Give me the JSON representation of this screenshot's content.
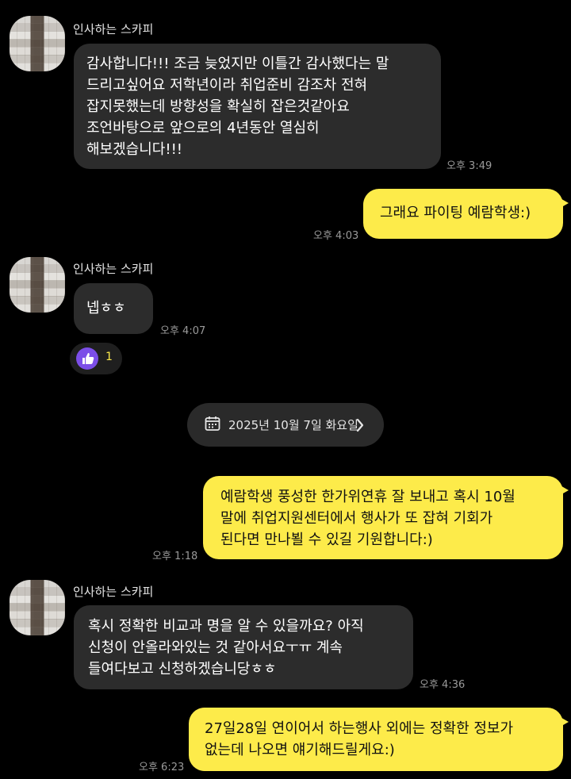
{
  "colors": {
    "background": "#000000",
    "incoming_bubble": "#2c2c2c",
    "outgoing_bubble": "#fdeb4a",
    "reaction_accent": "#7c4ee8",
    "reaction_count": "#fdeb4a"
  },
  "messages": [
    {
      "sender": "인사하는 스카피",
      "text": "감사합니다!!! 조금 늦었지만 이틀간 감사했다는 말\n드리고싶어요 저학년이라 취업준비 감조차 전혀\n잡지못했는데 방향성을 확실히 잡은것같아요\n조언바탕으로 앞으로의 4년동안 열심히\n해보겠습니다!!!",
      "time": "오후 3:49"
    },
    {
      "text": "그래요 파이팅 예람학생:)",
      "time": "오후 4:03"
    },
    {
      "sender": "인사하는 스카피",
      "text": "넵ㅎㅎ",
      "time": "오후 4:07",
      "reaction": {
        "icon": "thumbs-up-icon",
        "count": "1"
      }
    },
    {
      "text": "예람학생 풍성한 한가위연휴 잘 보내고 혹시 10월\n말에 취업지원센터에서 행사가 또 잡혀 기회가\n된다면 만나뵐 수 있길 기원합니다:)",
      "time": "오후 1:18"
    },
    {
      "sender": "인사하는 스카피",
      "text": "혹시 정확한 비교과 명을 알 수 있을까요? 아직\n신청이 안올라와있는 것 같아서요ㅜㅠ 계속\n들여다보고 신청하겠습니당ㅎㅎ",
      "time": "오후 4:36"
    },
    {
      "text": "27일28일 연이어서 하는행사 외에는 정확한 정보가\n없는데 나오면 얘기해드릴게요:)",
      "time": "오후 6:23"
    }
  ],
  "date_divider": {
    "icon": "calendar-icon",
    "label": "2025년 10월 7일 화요일",
    "chevron": "chevron-right-icon"
  }
}
